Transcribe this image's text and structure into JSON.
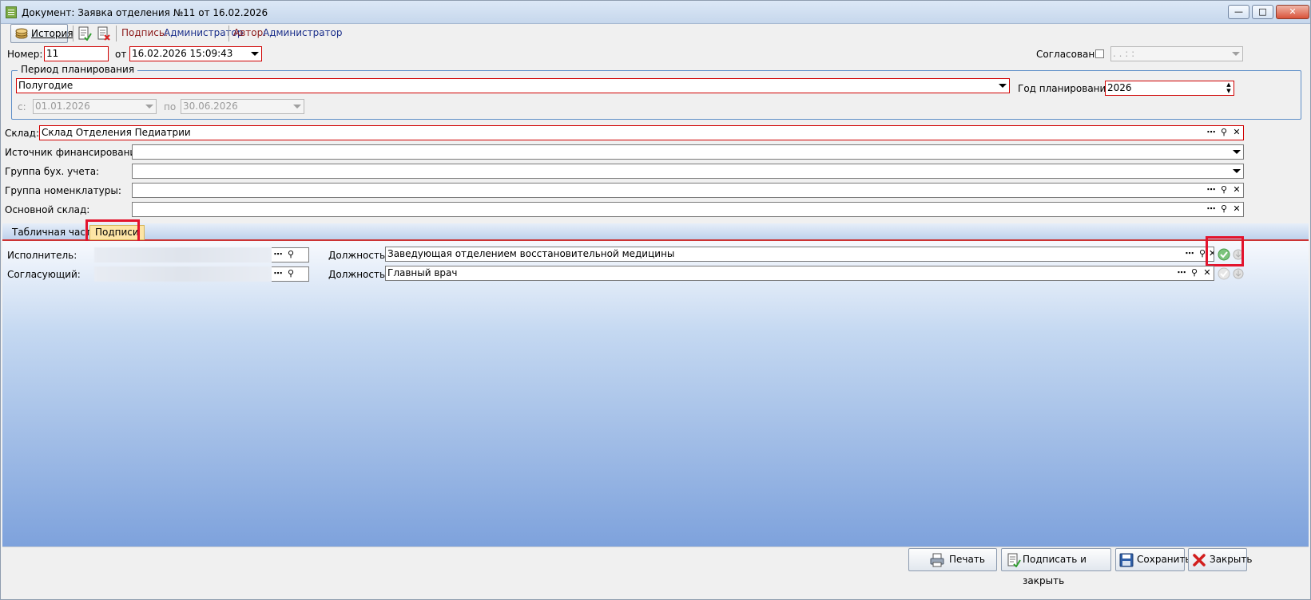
{
  "window": {
    "title": "Документ: Заявка отделения №11 от 16.02.2026",
    "minimize": "—",
    "maximize": "□",
    "close": "✕"
  },
  "toolbar": {
    "history_label": "История",
    "signature_label": "Подпись:",
    "signature_value": "Администратор",
    "author_label": "Автор:",
    "author_value": "Администратор"
  },
  "header": {
    "number_label": "Номер:",
    "number_value": "11",
    "from_label": "от",
    "date_value": "16.02.2026 15:09:43",
    "agreed_label": "Согласовано",
    "agreed_checked": false,
    "agreed_date_placeholder": " .  .       :  :"
  },
  "period": {
    "group_title": "Период планирования",
    "period_value": "Полугодие",
    "year_label": "Год планирования:",
    "year_value": "2026",
    "from_label": "с:",
    "from_value": "01.01.2026",
    "to_label": "по",
    "to_value": "30.06.2026"
  },
  "fields": {
    "warehouse_label": "Склад:",
    "warehouse_value": "Склад Отделения Педиатрии",
    "funding_label": "Источник финансирования:",
    "funding_value": "",
    "accounting_group_label": "Группа бух. учета:",
    "accounting_group_value": "",
    "nomenclature_group_label": "Группа номенклатуры:",
    "nomenclature_group_value": "",
    "main_warehouse_label": "Основной склад:",
    "main_warehouse_value": ""
  },
  "tabs": [
    {
      "label": "Табличная часть"
    },
    {
      "label": "Подписи"
    }
  ],
  "signatures": {
    "executor_label": "Исполнитель:",
    "approver_label": "Согласующий:",
    "position_label": "Должность:",
    "executor_position": "Заведующая отделением восстановительной медицины",
    "approver_position": "Главный врач"
  },
  "footer": {
    "print_label": "Печать",
    "sign_close_label": "Подписать и закрыть",
    "save_label": "Сохранить",
    "close_label": "Закрыть"
  },
  "colors": {
    "required_border": "#d00000",
    "highlight": "#e3142d",
    "active_tab": "#fde5a5",
    "panel_bottom": "#7ea2dc"
  }
}
